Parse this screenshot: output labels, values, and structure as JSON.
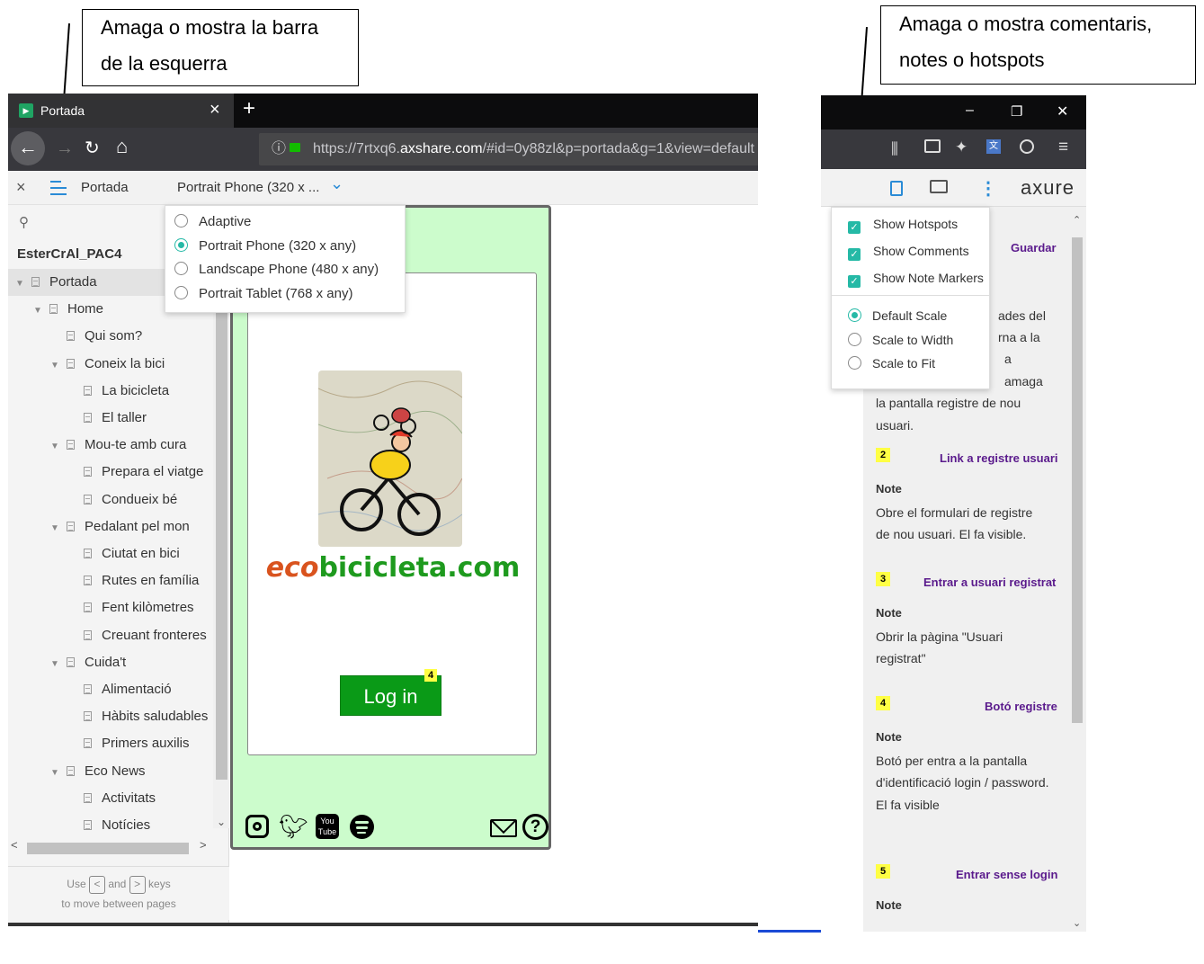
{
  "callouts": {
    "left_line1": "Amaga o mostra la barra",
    "left_line2": "de la esquerra",
    "right_line1": "Amaga o mostra comentaris,",
    "right_line2": "notes o hotspots"
  },
  "left_browser": {
    "tab_title": "Portada",
    "new_tab": "+",
    "close_tab": "×",
    "url_prefix": "https://7rtxq6.",
    "url_domain": "axshare.com",
    "url_rest": "/#id=0y88zl&p=portada&g=1&view=default",
    "info_icon": "ⓘ",
    "axure_toolbar": {
      "close": "×",
      "page_name": "Portada",
      "view_select": "Portrait Phone (320 x ...",
      "view_chevron": "⌄"
    },
    "view_options": [
      {
        "label": "Adaptive",
        "selected": false
      },
      {
        "label": "Portrait Phone (320 x any)",
        "selected": true
      },
      {
        "label": "Landscape Phone (480 x any)",
        "selected": false
      },
      {
        "label": "Portrait Tablet (768 x any)",
        "selected": false
      }
    ],
    "sidebar": {
      "search_icon": "⚲",
      "project": "EsterCrAl_PAC4",
      "tree": [
        {
          "label": "Portada",
          "level": 0,
          "arrow": "▼"
        },
        {
          "label": "Home",
          "level": 1,
          "arrow": "▼"
        },
        {
          "label": "Qui som?",
          "level": 2,
          "arrow": ""
        },
        {
          "label": "Coneix la bici",
          "level": 2,
          "arrow": "▼"
        },
        {
          "label": "La bicicleta",
          "level": 3,
          "arrow": ""
        },
        {
          "label": "El taller",
          "level": 3,
          "arrow": ""
        },
        {
          "label": "Mou-te amb cura",
          "level": 2,
          "arrow": "▼"
        },
        {
          "label": "Prepara el viatge",
          "level": 3,
          "arrow": ""
        },
        {
          "label": "Condueix bé",
          "level": 3,
          "arrow": ""
        },
        {
          "label": "Pedalant pel mon",
          "level": 2,
          "arrow": "▼"
        },
        {
          "label": "Ciutat en bici",
          "level": 3,
          "arrow": ""
        },
        {
          "label": "Rutes en família",
          "level": 3,
          "arrow": ""
        },
        {
          "label": "Fent kilòmetres",
          "level": 3,
          "arrow": ""
        },
        {
          "label": "Creuant fronteres",
          "level": 3,
          "arrow": ""
        },
        {
          "label": "Cuida't",
          "level": 2,
          "arrow": "▼"
        },
        {
          "label": "Alimentació",
          "level": 3,
          "arrow": ""
        },
        {
          "label": "Hàbits saludables",
          "level": 3,
          "arrow": ""
        },
        {
          "label": "Primers auxilis",
          "level": 3,
          "arrow": ""
        },
        {
          "label": "Eco News",
          "level": 2,
          "arrow": "▼"
        },
        {
          "label": "Activitats",
          "level": 3,
          "arrow": ""
        },
        {
          "label": "Notícies",
          "level": 3,
          "arrow": ""
        }
      ],
      "hint_use": "Use",
      "hint_and": "and",
      "hint_keys": "keys",
      "hint_line2": "to move between pages",
      "key_prev": "<",
      "key_next": ">"
    },
    "prototype": {
      "logo_eco": "eco",
      "logo_rest": "bicicleta.com",
      "login_label": "Log in",
      "login_badge": "4",
      "logo_color": "#d9531e",
      "text_color": "#1e9a1e"
    }
  },
  "right_browser": {
    "window_minimize": "–",
    "window_restore": "❐",
    "window_close": "✕",
    "axure_brand": "axure",
    "menu_checks": [
      {
        "label": "Show Hotspots",
        "checked": true
      },
      {
        "label": "Show Comments",
        "checked": true
      },
      {
        "label": "Show Note Markers",
        "checked": true
      }
    ],
    "scale_options": [
      {
        "label": "Default Scale",
        "selected": true
      },
      {
        "label": "Scale to Width",
        "selected": false
      },
      {
        "label": "Scale to Fit",
        "selected": false
      }
    ],
    "notes": {
      "n1_heading": "Guardar",
      "n1_frag1": "ades del",
      "n1_frag2": "rna a la",
      "n1_frag3": "a",
      "n1_frag4": "amaga",
      "n1_line5": "la pantalla registre de nou",
      "n1_line6": "usuari.",
      "n2_num": "2",
      "n2_heading": "Link a registre usuari",
      "n2_label": "Note",
      "n2_line1": "Obre el formulari de registre",
      "n2_line2": "de nou usuari.  El fa visible.",
      "n3_num": "3",
      "n3_heading": "Entrar a usuari registrat",
      "n3_label": "Note",
      "n3_line1": "Obrir la pàgina \"Usuari",
      "n3_line2": "registrat\"",
      "n4_num": "4",
      "n4_heading": "Botó registre",
      "n4_label": "Note",
      "n4_line1": "Botó per entra a la pantalla",
      "n4_line2": "d'identificació login / password.",
      "n4_line3": "El fa visible",
      "n5_num": "5",
      "n5_heading": "Entrar sense login",
      "n5_label": "Note"
    }
  }
}
